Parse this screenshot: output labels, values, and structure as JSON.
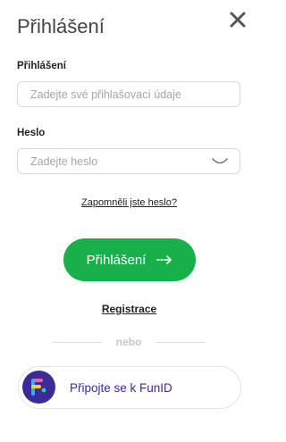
{
  "modal": {
    "title": "Přihlášení",
    "close_icon": "close-icon"
  },
  "login": {
    "label": "Přihlášení",
    "placeholder": "Zadejte své přihlašovací údaje"
  },
  "password": {
    "label": "Heslo",
    "placeholder": "Zadejte heslo",
    "toggle_icon": "eye-closed-icon"
  },
  "links": {
    "forgot": "Zapomněli jste heslo?",
    "register": "Registrace"
  },
  "submit": {
    "label": "Přihlášení",
    "icon": "arrow-right-icon"
  },
  "divider": {
    "text": "nebo"
  },
  "funid": {
    "label": "Připojte se k FunID",
    "logo": "funid-logo-icon"
  },
  "colors": {
    "accent_green": "#18b04a",
    "funid_purple": "#3c2a96",
    "field_border": "#d9d4f0"
  }
}
